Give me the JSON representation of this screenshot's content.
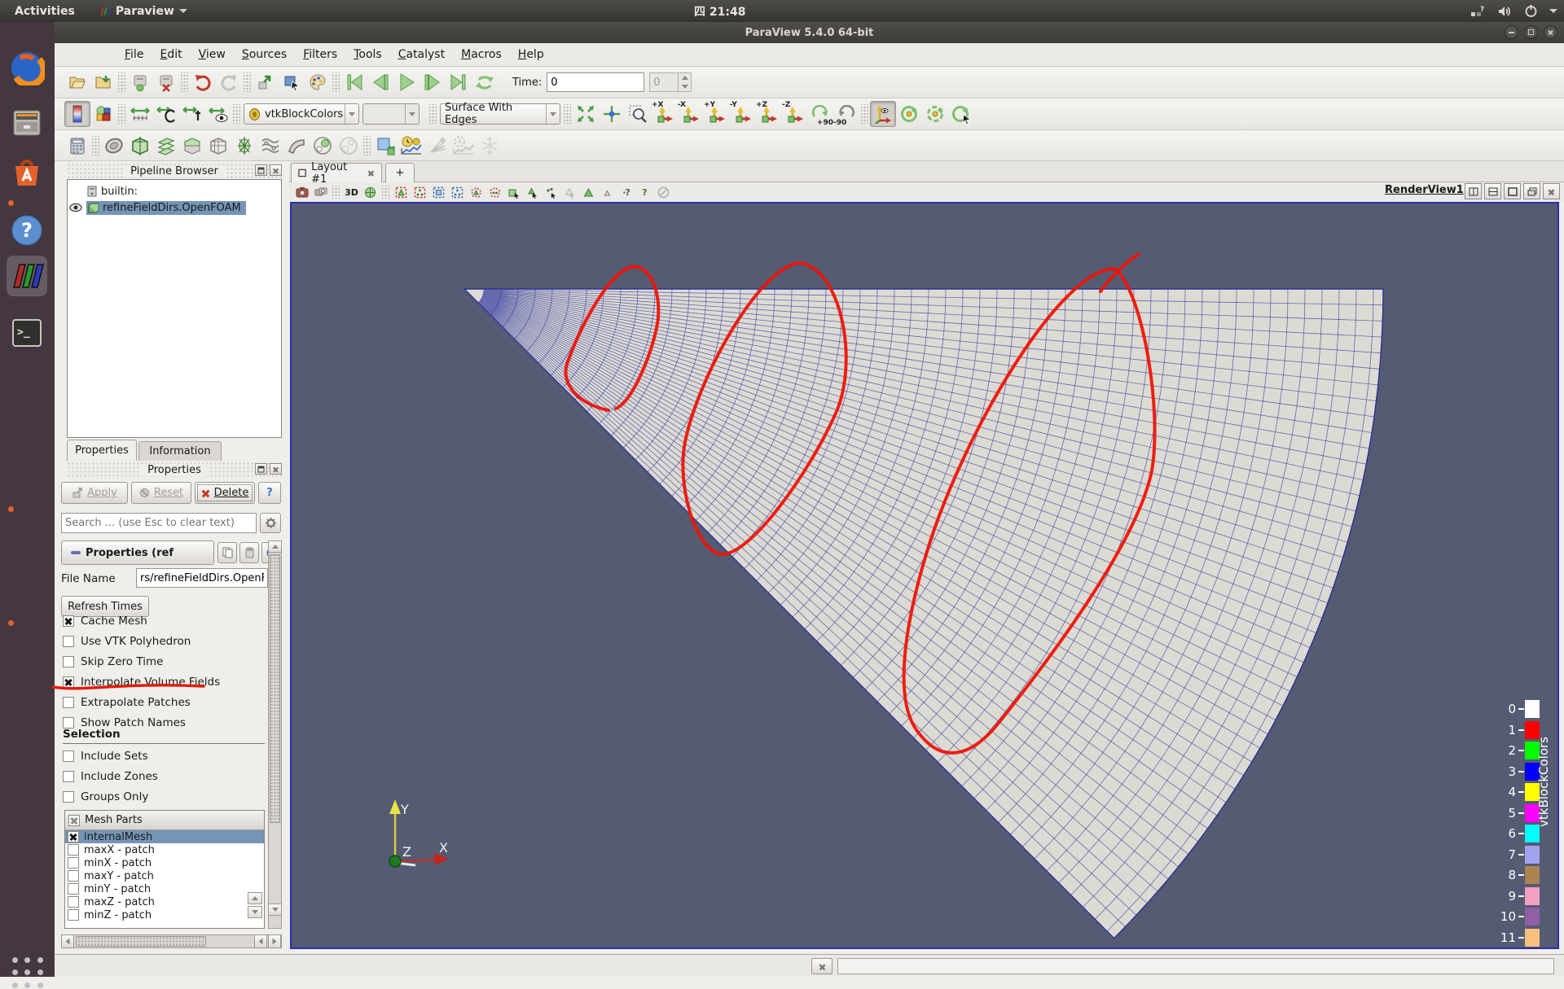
{
  "os_bar": {
    "activities": "Activities",
    "app_menu": "Paraview",
    "clock": "四 21:48"
  },
  "window": {
    "title": "ParaView 5.4.0 64-bit"
  },
  "menu_bar": {
    "items": [
      "File",
      "Edit",
      "View",
      "Sources",
      "Filters",
      "Tools",
      "Catalyst",
      "Macros",
      "Help"
    ]
  },
  "toolbar_time": {
    "label": "Time:",
    "value": "0",
    "frame": "0"
  },
  "toolbar_display": {
    "array_combo": "vtkBlockColors",
    "component_combo": "",
    "representation_combo": "Surface With Edges",
    "axis_labels": [
      "+X",
      "-X",
      "+Y",
      "-Y",
      "+Z",
      "-Z"
    ],
    "rotate_labels": [
      "+90",
      "-90"
    ]
  },
  "pipeline": {
    "title": "Pipeline Browser",
    "root": "builtin:",
    "source": "refineFieldDirs.OpenFOAM"
  },
  "panel_tabs": {
    "properties": "Properties",
    "information": "Information"
  },
  "properties": {
    "dock_title": "Properties",
    "apply": "Apply",
    "reset": "Reset",
    "delete": "Delete",
    "search_placeholder": "Search ... (use Esc to clear text)",
    "section_header": "Properties (ref",
    "file_name_label": "File Name",
    "file_name_value": "rs/refineFieldDirs.OpenFOAM",
    "refresh_times": "Refresh Times",
    "checkboxes": [
      {
        "label": "Cache Mesh",
        "checked": true
      },
      {
        "label": "Use VTK Polyhedron",
        "checked": false
      },
      {
        "label": "Skip Zero Time",
        "checked": false
      },
      {
        "label": "Interpolate Volume Fields",
        "checked": true,
        "annotated": true
      },
      {
        "label": "Extrapolate Patches",
        "checked": false
      },
      {
        "label": "Show Patch Names",
        "checked": false
      }
    ],
    "selection_header": "Selection",
    "selection_checkboxes": [
      {
        "label": "Include Sets",
        "checked": false
      },
      {
        "label": "Include Zones",
        "checked": false
      },
      {
        "label": "Groups Only",
        "checked": false
      }
    ],
    "mesh_parts": {
      "header": "Mesh Parts",
      "items": [
        {
          "label": "internalMesh",
          "checked": true,
          "selected": true
        },
        {
          "label": "maxX - patch",
          "checked": false
        },
        {
          "label": "minX - patch",
          "checked": false
        },
        {
          "label": "maxY - patch",
          "checked": false
        },
        {
          "label": "minY - patch",
          "checked": false
        },
        {
          "label": "maxZ - patch",
          "checked": false
        },
        {
          "label": "minZ - patch",
          "checked": false
        }
      ]
    }
  },
  "layout": {
    "tab": "Layout #1",
    "new_tab": "+",
    "mode_3d": "3D"
  },
  "render_view": {
    "title": "RenderView1",
    "axes": {
      "x": "X",
      "y": "Y",
      "z": "Z"
    },
    "background": "#555b72",
    "legend": {
      "title": "vtkBlockColors",
      "entries": [
        {
          "label": "0",
          "color": "#ffffff"
        },
        {
          "label": "1",
          "color": "#fd0000"
        },
        {
          "label": "2",
          "color": "#00fe00"
        },
        {
          "label": "3",
          "color": "#0000fb"
        },
        {
          "label": "4",
          "color": "#fffd00"
        },
        {
          "label": "5",
          "color": "#fb00fb"
        },
        {
          "label": "6",
          "color": "#00fdfd"
        },
        {
          "label": "7",
          "color": "#a2a2ef"
        },
        {
          "label": "8",
          "color": "#ab8351"
        },
        {
          "label": "9",
          "color": "#f1a2c2"
        },
        {
          "label": "10",
          "color": "#8f60a5"
        },
        {
          "label": "11",
          "color": "#f6c17e"
        }
      ]
    }
  },
  "icons": {
    "help": "?",
    "terminal_prompt": ">_",
    "network_unknown": "?"
  },
  "colors": {
    "selection_highlight": "#7495b5",
    "annotation_red": "#ee1507",
    "mesh_fill": "#dcdbd3",
    "mesh_line": "#343a9e",
    "view_border": "#2e2eb2",
    "viewport_bg": "#555b72"
  }
}
